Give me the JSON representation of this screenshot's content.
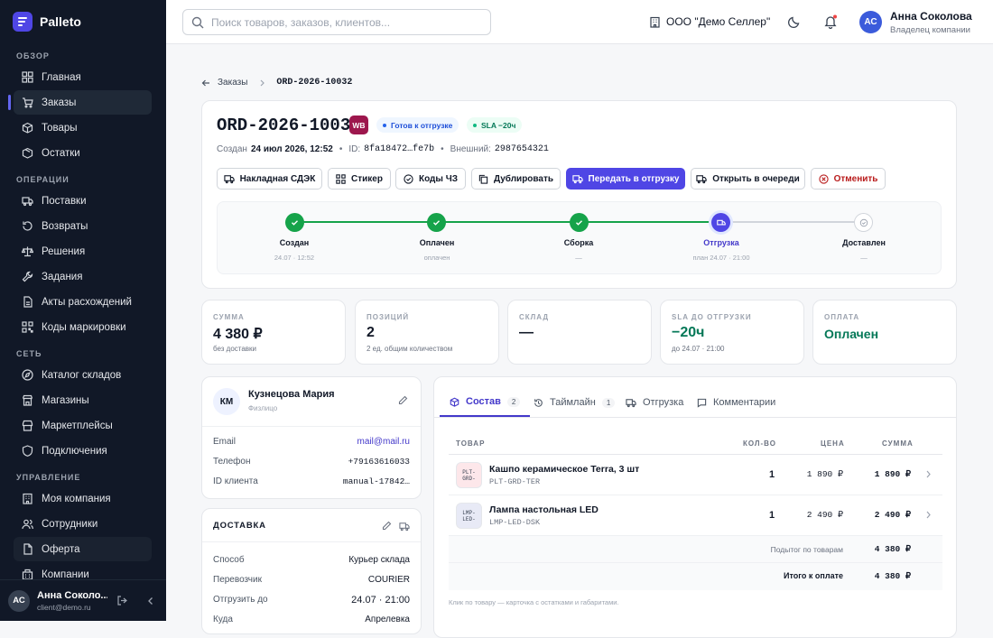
{
  "brand": {
    "name": "Palleto",
    "accent": "#4f46e5"
  },
  "sidebar": {
    "sections": [
      "ОБЗОР",
      "ОПЕРАЦИИ",
      "СЕТЬ",
      "УПРАВЛЕНИЕ"
    ],
    "items": [
      {
        "label": "Главная",
        "icon": "grid-icon"
      },
      {
        "label": "Заказы",
        "icon": "cart-icon"
      },
      {
        "label": "Товары",
        "icon": "box-icon"
      },
      {
        "label": "Остатки",
        "icon": "package-icon"
      },
      {
        "label": "Поставки",
        "icon": "truck-icon"
      },
      {
        "label": "Возвраты",
        "icon": "undo-icon"
      },
      {
        "label": "Решения",
        "icon": "scale-icon"
      },
      {
        "label": "Задания",
        "icon": "wrench-icon"
      },
      {
        "label": "Акты расхождений",
        "icon": "document-icon"
      },
      {
        "label": "Коды маркировки",
        "icon": "qr-icon"
      },
      {
        "label": "Каталог складов",
        "icon": "compass-icon"
      },
      {
        "label": "Магазины",
        "icon": "store-icon"
      },
      {
        "label": "Маркетплейсы",
        "icon": "globe-icon"
      },
      {
        "label": "Подключения",
        "icon": "shield-icon"
      },
      {
        "label": "Моя компания",
        "icon": "building-icon"
      },
      {
        "label": "Сотрудники",
        "icon": "users-icon"
      },
      {
        "label": "Оферта",
        "icon": "document-icon"
      },
      {
        "label": "Компании",
        "icon": "building-icon"
      }
    ],
    "user": {
      "initials": "АС",
      "name": "Анна Соколо...",
      "email": "client@demo.ru"
    }
  },
  "topbar": {
    "search_placeholder": "Поиск товаров, заказов, клиентов...",
    "company": "ООО \"Демо Селлер\"",
    "user_initials": "АС",
    "user_name": "Анна Соколова",
    "user_role": "Владелец компании"
  },
  "breadcrumb": {
    "parent": "Заказы",
    "current": "ORD-2026-10032"
  },
  "order": {
    "id": "ORD-2026-10032",
    "marketplace_badge": "WB",
    "status": "Готов к отгрузке",
    "sla": "SLA −20ч",
    "created_label": "Создан",
    "created_value": "24 июл 2026, 12:52",
    "id_label": "ID:",
    "id_value": "8fa18472…fe7b",
    "external_label": "Внешний:",
    "external_value": "2987654321"
  },
  "actions": [
    "Накладная СДЭК",
    "Стикер",
    "Коды ЧЗ",
    "Дублировать",
    "Передать в отгрузку",
    "Открыть в очереди",
    "Отменить"
  ],
  "steps": [
    {
      "label": "Создан",
      "sub": "24.07 · 12:52",
      "state": "done"
    },
    {
      "label": "Оплачен",
      "sub": "оплачен",
      "state": "done"
    },
    {
      "label": "Сборка",
      "sub": "—",
      "state": "done"
    },
    {
      "label": "Отгрузка",
      "sub": "план 24.07 · 21:00",
      "state": "current"
    },
    {
      "label": "Доставлен",
      "sub": "—",
      "state": "pending"
    }
  ],
  "kpis": [
    {
      "label": "СУММА",
      "value": "4 380 ₽",
      "sub": "без доставки"
    },
    {
      "label": "ПОЗИЦИЙ",
      "value": "2",
      "sub": "2 ед. общим количеством"
    },
    {
      "label": "СКЛАД",
      "value": "—",
      "sub": ""
    },
    {
      "label": "SLA ДО ОТГРУЗКИ",
      "value": "−20ч",
      "sub": "до 24.07 · 21:00"
    },
    {
      "label": "ОПЛАТА",
      "value": "Оплачен",
      "sub": ""
    }
  ],
  "customer": {
    "initials": "КМ",
    "name": "Кузнецова Мария",
    "type": "Физлицо",
    "rows": [
      {
        "label": "Email",
        "value": "mail@mail.ru"
      },
      {
        "label": "Телефон",
        "value": "+79163616033"
      },
      {
        "label": "ID клиента",
        "value": "manual-17842…"
      }
    ]
  },
  "delivery": {
    "title": "ДОСТАВКА",
    "rows": [
      {
        "label": "Способ",
        "value": "Курьер склада"
      },
      {
        "label": "Перевозчик",
        "value": "COURIER"
      },
      {
        "label": "Отгрузить до",
        "value": "24.07 · 21:00"
      },
      {
        "label": "Куда",
        "value": "Апрелевка"
      }
    ]
  },
  "tabs": [
    {
      "label": "Состав",
      "count": "2"
    },
    {
      "label": "Таймлайн",
      "count": "1"
    },
    {
      "label": "Отгрузка",
      "count": ""
    },
    {
      "label": "Комментарии",
      "count": ""
    }
  ],
  "table": {
    "headers": [
      "ТОВАР",
      "КОЛ-ВО",
      "ЦЕНА",
      "СУММА"
    ],
    "rows": [
      {
        "name": "Кашпо керамическое Terra, 3 шт",
        "sku": "PLT-GRD-TER",
        "thumb": "PLT-\nGRD-",
        "qty": "1",
        "price": "1 890 ₽",
        "sum": "1 890 ₽"
      },
      {
        "name": "Лампа настольная LED",
        "sku": "LMP-LED-DSK",
        "thumb": "LMP-\nLED-",
        "qty": "1",
        "price": "2 490 ₽",
        "sum": "2 490 ₽"
      }
    ],
    "subtotal_label": "Подытог по товарам",
    "subtotal": "4 380 ₽",
    "total_label": "Итого к оплате",
    "total": "4 380 ₽",
    "hint": "Клик по товару — карточка с остатками и габаритами."
  },
  "colors": {
    "success": "#16a34a",
    "primary": "#4f46e5",
    "danger": "#b91c1c",
    "wb": "#9d174d"
  }
}
